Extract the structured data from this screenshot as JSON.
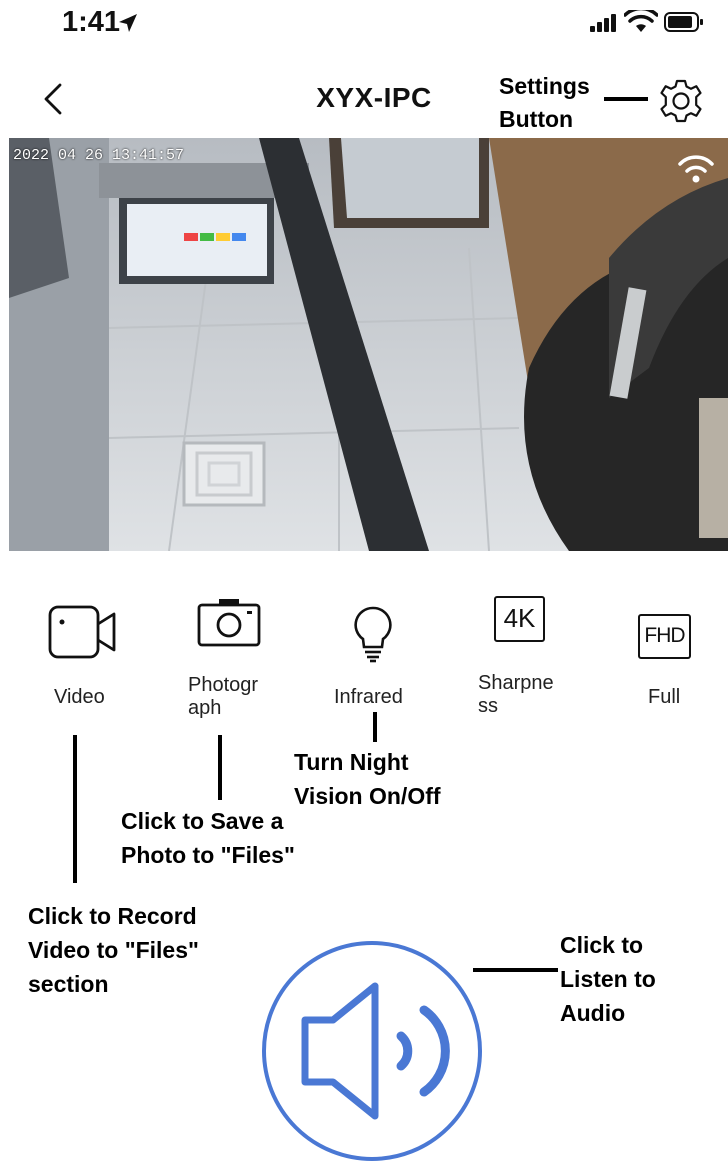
{
  "status_bar": {
    "time": "1:41"
  },
  "nav": {
    "title": "XYX-IPC"
  },
  "feed": {
    "timestamp": "2022 04 26 13:41:57"
  },
  "controls": [
    {
      "label": "Video",
      "icon": "video-camera-icon"
    },
    {
      "label": "Photogr\naph",
      "icon": "camera-icon"
    },
    {
      "label": "Infrared",
      "icon": "lightbulb-icon"
    },
    {
      "label": "Sharpne\nss",
      "icon": "4k-icon"
    },
    {
      "label": "Full",
      "icon": "fhd-icon"
    }
  ],
  "icon_text": {
    "four_k": "4K",
    "fhd": "FHD"
  },
  "annotations": {
    "settings": "Settings\nButton",
    "night_vision": "Turn Night\nVision On/Off",
    "photo": "Click to Save a\nPhoto to \"Files\"",
    "video": "Click to Record\nVideo to \"Files\"\nsection",
    "audio": "Click to\nListen to\nAudio"
  },
  "colors": {
    "accent": "#4a78d4",
    "text": "#111111",
    "annotation": "#000000"
  },
  "speaker": {
    "icon": "speaker-volume-icon"
  }
}
